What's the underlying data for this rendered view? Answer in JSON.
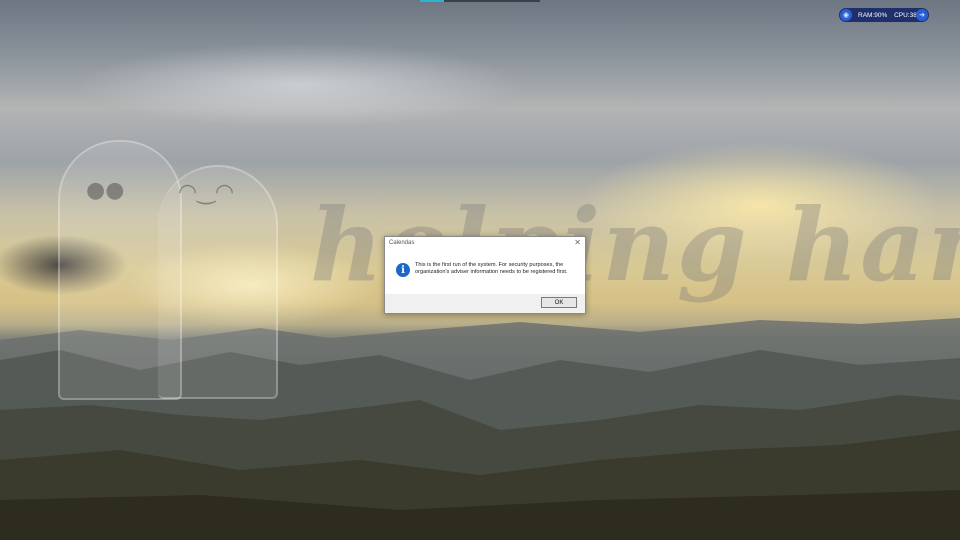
{
  "desktop": {
    "watermark_text": "helping hand"
  },
  "system_monitor": {
    "ram": "RAM:90%",
    "cpu": "CPU:38%"
  },
  "dialog": {
    "title": "Calendas",
    "close_glyph": "✕",
    "icon": "info-icon",
    "message": "This is the first run of the system. For security purposes, the organization's adviser information needs to be registered first.",
    "ok_label": "OK"
  },
  "colors": {
    "info_icon": "#1a68c8",
    "monitor_bg": "#1f2f6b"
  }
}
